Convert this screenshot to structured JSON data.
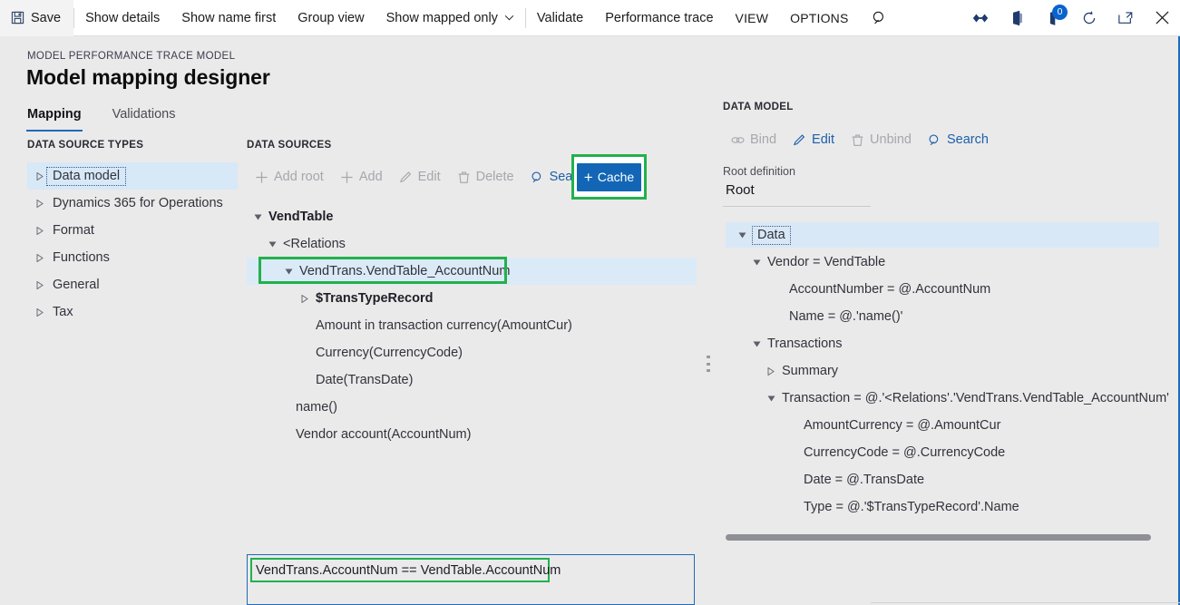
{
  "topbar": {
    "save_label": "Save",
    "items": [
      {
        "label": "Show details"
      },
      {
        "label": "Show name first"
      },
      {
        "label": "Group view"
      },
      {
        "label": "Show mapped only"
      },
      {
        "label": "Validate"
      },
      {
        "label": "Performance trace"
      }
    ],
    "view_label": "VIEW",
    "options_label": "OPTIONS",
    "notification_count": "0",
    "icons": {
      "save": "save-icon",
      "search": "search-icon",
      "chevron": "chevron-down-icon",
      "settings": "settings-icon",
      "office": "office-app-icon",
      "notifications": "notifications-icon",
      "refresh": "refresh-icon",
      "popout": "popout-icon",
      "close": "close-icon"
    }
  },
  "header": {
    "eyebrow": "MODEL PERFORMANCE TRACE MODEL",
    "title": "Model mapping designer",
    "tabs": [
      {
        "label": "Mapping",
        "active": true
      },
      {
        "label": "Validations",
        "active": false
      }
    ]
  },
  "data_source_types": {
    "section_label": "DATA SOURCE TYPES",
    "items": [
      {
        "label": "Data model",
        "selected": true
      },
      {
        "label": "Dynamics 365 for Operations",
        "selected": false
      },
      {
        "label": "Format",
        "selected": false
      },
      {
        "label": "Functions",
        "selected": false
      },
      {
        "label": "General",
        "selected": false
      },
      {
        "label": "Tax",
        "selected": false
      }
    ]
  },
  "data_sources": {
    "section_label": "DATA SOURCES",
    "toolbar": [
      {
        "label": "Add root",
        "icon": "plus-icon",
        "enabled": false
      },
      {
        "label": "Add",
        "icon": "plus-icon",
        "enabled": false
      },
      {
        "label": "Edit",
        "icon": "pencil-icon",
        "enabled": false
      },
      {
        "label": "Delete",
        "icon": "trash-icon",
        "enabled": false
      },
      {
        "label": "Search",
        "icon": "search-icon",
        "enabled": true
      }
    ],
    "cache_label": "Cache",
    "tree": [
      {
        "label": "VendTable",
        "indent": 0,
        "twisty": "expanded",
        "bold": true,
        "highlight": false,
        "outline": false
      },
      {
        "label": "<Relations",
        "indent": 1,
        "twisty": "expanded",
        "bold": false,
        "highlight": false,
        "outline": false
      },
      {
        "label": "VendTrans.VendTable_AccountNum",
        "indent": 2,
        "twisty": "expanded",
        "bold": false,
        "highlight": true,
        "outline": true
      },
      {
        "label": "$TransTypeRecord",
        "indent": 3,
        "twisty": "collapsed",
        "bold": true,
        "highlight": false,
        "outline": false
      },
      {
        "label": "Amount in transaction currency(AmountCur)",
        "indent": 3,
        "twisty": "none",
        "bold": false,
        "highlight": false,
        "outline": false
      },
      {
        "label": "Currency(CurrencyCode)",
        "indent": 3,
        "twisty": "none",
        "bold": false,
        "highlight": false,
        "outline": false
      },
      {
        "label": "Date(TransDate)",
        "indent": 3,
        "twisty": "none",
        "bold": false,
        "highlight": false,
        "outline": false
      },
      {
        "label": "name()",
        "indent": 2,
        "twisty": "none",
        "bold": false,
        "highlight": false,
        "outline": false
      },
      {
        "label": "Vendor account(AccountNum)",
        "indent": 2,
        "twisty": "none",
        "bold": false,
        "highlight": false,
        "outline": false
      }
    ]
  },
  "data_model": {
    "section_label": "DATA MODEL",
    "toolbar": [
      {
        "label": "Bind",
        "icon": "link-icon",
        "enabled": false
      },
      {
        "label": "Edit",
        "icon": "pencil-icon",
        "enabled": true
      },
      {
        "label": "Unbind",
        "icon": "trash-icon",
        "enabled": false
      },
      {
        "label": "Search",
        "icon": "search-icon",
        "enabled": true
      }
    ],
    "root_definition_label": "Root definition",
    "root_definition_value": "Root",
    "tree": [
      {
        "label": "Data",
        "indent": 0,
        "twisty": "expanded",
        "highlight": true,
        "outline": true
      },
      {
        "label": "Vendor = VendTable",
        "indent": 1,
        "twisty": "expanded",
        "highlight": false,
        "outline": false
      },
      {
        "label": "AccountNumber = @.AccountNum",
        "indent": 2,
        "twisty": "none",
        "highlight": false,
        "outline": false
      },
      {
        "label": "Name = @.'name()'",
        "indent": 2,
        "twisty": "none",
        "highlight": false,
        "outline": false
      },
      {
        "label": "Transactions",
        "indent": 1,
        "twisty": "expanded",
        "highlight": false,
        "outline": false
      },
      {
        "label": "Summary",
        "indent": 2,
        "twisty": "collapsed",
        "highlight": false,
        "outline": false
      },
      {
        "label": "Transaction = @.'<Relations'.'VendTrans.VendTable_AccountNum'",
        "indent": 2,
        "twisty": "expanded",
        "highlight": false,
        "outline": false
      },
      {
        "label": "AmountCurrency = @.AmountCur",
        "indent": 3,
        "twisty": "none",
        "highlight": false,
        "outline": false
      },
      {
        "label": "CurrencyCode = @.CurrencyCode",
        "indent": 3,
        "twisty": "none",
        "highlight": false,
        "outline": false
      },
      {
        "label": "Date = @.TransDate",
        "indent": 3,
        "twisty": "none",
        "highlight": false,
        "outline": false
      },
      {
        "label": "Type = @.'$TransTypeRecord'.Name",
        "indent": 3,
        "twisty": "none",
        "highlight": false,
        "outline": false
      }
    ]
  },
  "expression": {
    "value": "VendTrans.AccountNum == VendTable.AccountNum"
  },
  "colors": {
    "accent_blue": "#1266b5",
    "link_blue": "#1e5fa8",
    "highlight_green": "#22b14c",
    "selection_blue": "#d9e8f6",
    "page_bg": "#eaeaea"
  }
}
